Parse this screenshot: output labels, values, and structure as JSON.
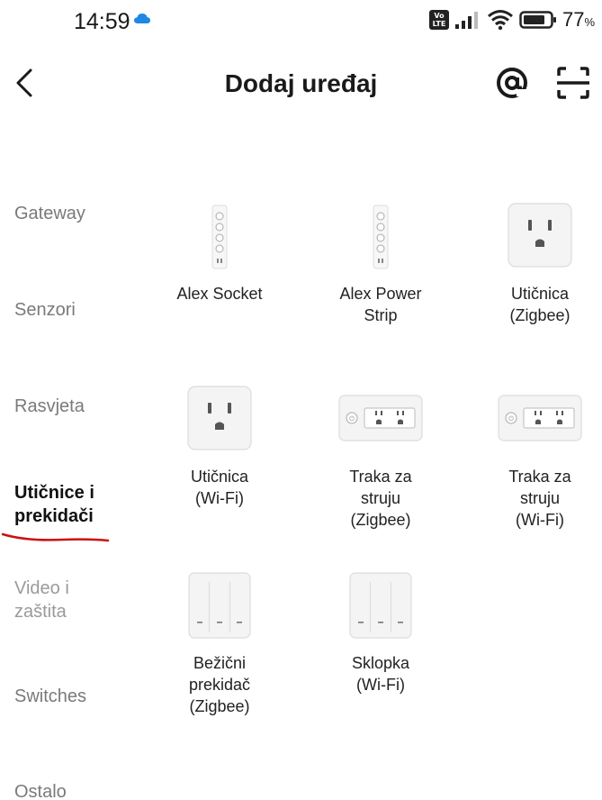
{
  "status_bar": {
    "time": "14:59",
    "battery": "77",
    "battery_unit": "%",
    "volte_line1": "Vo",
    "volte_line2": "LTE",
    "cloud_color": "#1e88e5"
  },
  "header": {
    "title": "Dodaj uređaj",
    "back_icon": "chevron-left-icon",
    "scan_icon_1": "at-sign-icon",
    "scan_icon_2": "scan-frame-icon"
  },
  "sidebar": {
    "items": [
      {
        "label": "Gateway",
        "active": false
      },
      {
        "label": "Senzori",
        "active": false
      },
      {
        "label": "Rasvjeta",
        "active": false
      },
      {
        "label": "Utičnice i\nprekidači",
        "active": true
      },
      {
        "label": "Video i\nzaštita",
        "active": false
      },
      {
        "label": "Switches",
        "active": false
      },
      {
        "label": "Ostalo",
        "active": false
      }
    ],
    "underline_color": "#cc1111"
  },
  "devices": [
    {
      "label": "Alex Socket",
      "icon": "power-strip-vertical-icon"
    },
    {
      "label": "Alex Power\nStrip",
      "icon": "power-strip-vertical-icon"
    },
    {
      "label": "Utičnica\n(Zigbee)",
      "icon": "wall-outlet-icon"
    },
    {
      "label": "Utičnica\n(Wi-Fi)",
      "icon": "wall-outlet-icon"
    },
    {
      "label": "Traka za\nstruju\n(Zigbee)",
      "icon": "power-strip-horizontal-icon"
    },
    {
      "label": "Traka za\nstruju\n(Wi-Fi)",
      "icon": "power-strip-horizontal-icon"
    },
    {
      "label": "Bežični\nprekidač\n(Zigbee)",
      "icon": "wall-switch-icon"
    },
    {
      "label": "Sklopka\n(Wi-Fi)",
      "icon": "wall-switch-icon"
    }
  ]
}
